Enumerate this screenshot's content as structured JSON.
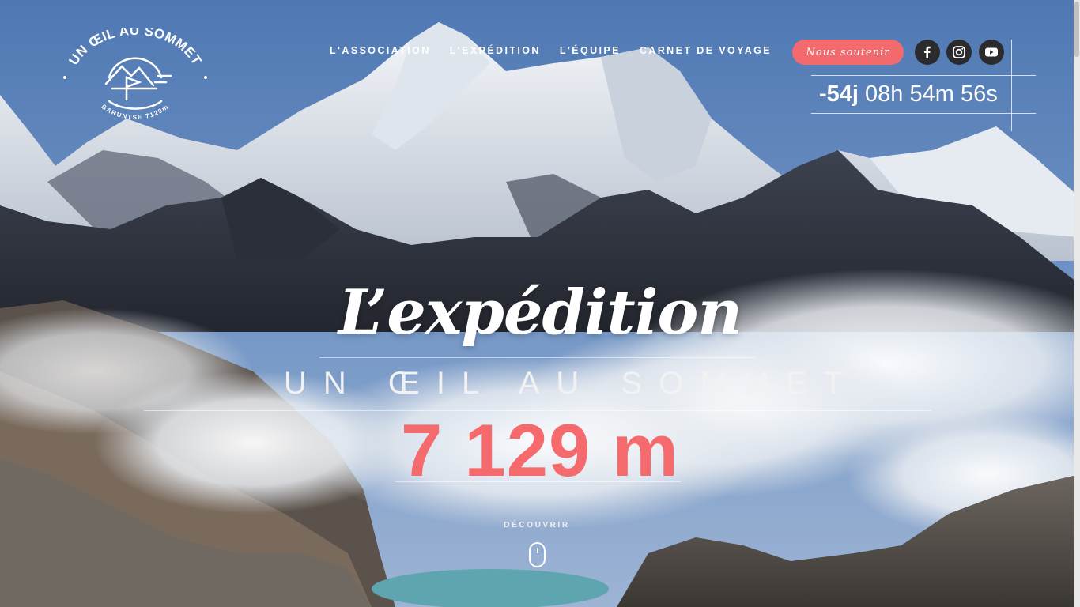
{
  "logo": {
    "text_top": "UN ŒIL AU SOMMET",
    "text_bottom": "BARUNTSE 7129m"
  },
  "nav": {
    "items": [
      {
        "label": "L'ASSOCIATION"
      },
      {
        "label": "L'EXPÉDITION"
      },
      {
        "label": "L'ÉQUIPE"
      },
      {
        "label": "CARNET DE VOYAGE"
      }
    ],
    "support_label": "Nous soutenir",
    "support_color": "#f36a6e"
  },
  "social": [
    {
      "icon": "facebook-icon"
    },
    {
      "icon": "instagram-icon"
    },
    {
      "icon": "youtube-icon"
    }
  ],
  "countdown": {
    "days": "-54j",
    "rest": " 08h 54m 56s"
  },
  "hero": {
    "title": "L’expédition",
    "subtitle": "UN ŒIL AU SOMMET",
    "altitude": "7 129 m",
    "altitude_color": "#f56a6c",
    "discover_label": "DÉCOUVRIR"
  }
}
